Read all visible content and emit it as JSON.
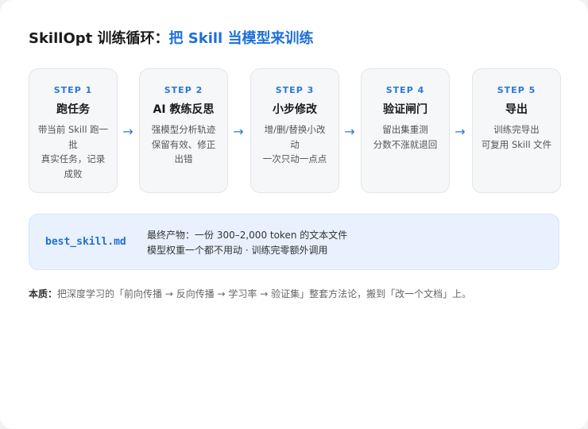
{
  "title": {
    "prefix": "SkillOpt 训练循环：",
    "highlight": "把 Skill 当模型来训练"
  },
  "steps": [
    {
      "label": "STEP 1",
      "title": "跑任务",
      "desc": [
        "带当前 Skill 跑一批",
        "真实任务，记录",
        "成败"
      ]
    },
    {
      "label": "STEP 2",
      "title": "AI 教练反思",
      "desc": [
        "强模型分析轨迹",
        "保留有效、修正",
        "出错"
      ]
    },
    {
      "label": "STEP 3",
      "title": "小步修改",
      "desc": [
        "增/删/替换小改",
        "动",
        "一次只动一点点"
      ]
    },
    {
      "label": "STEP 4",
      "title": "验证闸门",
      "desc": [
        "留出集重测",
        "分数不涨就退回"
      ]
    },
    {
      "label": "STEP 5",
      "title": "导出",
      "desc": [
        "训练完导出",
        "可复用 Skill 文件"
      ]
    }
  ],
  "arrow_glyph": "→",
  "product": {
    "filename": "best_skill.md",
    "line1": "最终产物：一份 300–2,000 token 的文本文件",
    "line2": "模型权重一个都不用动 · 训练完零额外调用"
  },
  "footnote": {
    "key": "本质：",
    "text": "把深度学习的「前向传播 → 反向传播 → 学习率 → 验证集」整套方法论，搬到「改一个文档」上。"
  },
  "colors": {
    "accent": "#1e6fd9",
    "step_card_bg": "#f6f7f9",
    "product_bg": "#e8f1fd"
  }
}
